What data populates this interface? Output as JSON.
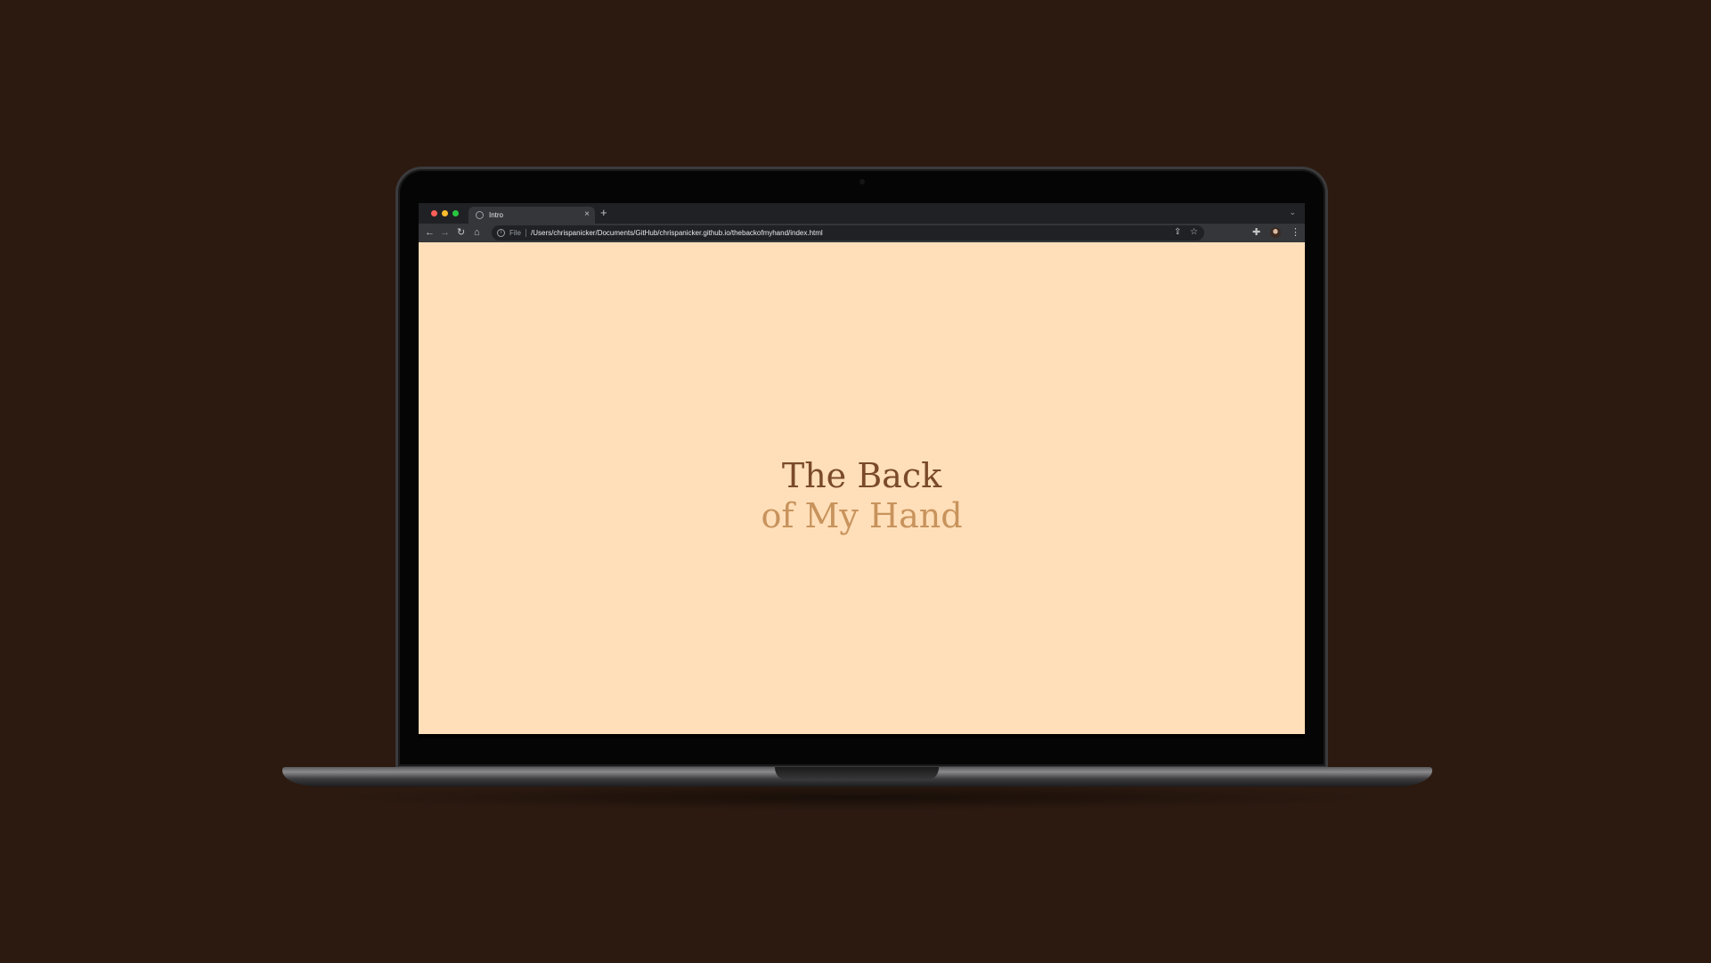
{
  "browser": {
    "tab_title": "Intro",
    "tab_close": "×",
    "new_tab": "+",
    "file_label": "File",
    "url": "/Users/chrispanicker/Documents/GitHub/chrispanicker.github.io/thebackofmyhand/index.html"
  },
  "page": {
    "title_line1": "The Back",
    "title_line2": "of My Hand"
  },
  "colors": {
    "background": "#2c1a10",
    "page_bg": "#ffdfb9",
    "title_dark": "#7a4a2a",
    "title_light": "#c8935c"
  },
  "icons": [
    "back-icon",
    "forward-icon",
    "reload-icon",
    "home-icon",
    "share-icon",
    "bookmark-star-icon",
    "extensions-icon",
    "menu-icon"
  ]
}
